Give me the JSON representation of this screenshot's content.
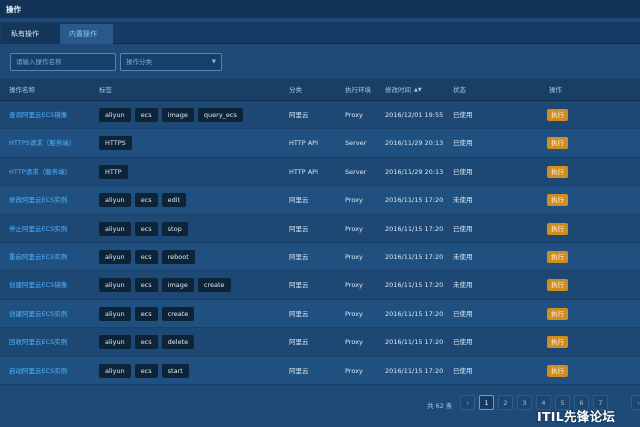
{
  "header": {
    "title": "操作"
  },
  "tabs": [
    {
      "label": "私有操作"
    },
    {
      "label": "内置操作"
    }
  ],
  "filters": {
    "search_placeholder": "请输入操作名称",
    "category_placeholder": "操作分类"
  },
  "table": {
    "columns": [
      "操作名称",
      "标签",
      "分类",
      "执行环境",
      "修改时间",
      "状态",
      "操作"
    ],
    "rows": [
      {
        "name": "查询阿里云ECS镜像",
        "tags": [
          "aliyun",
          "ecs",
          "image",
          "query_ecs"
        ],
        "category": "阿里云",
        "env": "Proxy",
        "time": "2016/12/01 19:55",
        "status": "已使用",
        "action": "执行"
      },
      {
        "name": "HTTPS请求（服务端）",
        "tags": [
          "HTTPS"
        ],
        "category": "HTTP API",
        "env": "Server",
        "time": "2016/11/29 20:13",
        "status": "已使用",
        "action": "执行"
      },
      {
        "name": "HTTP请求（服务端）",
        "tags": [
          "HTTP"
        ],
        "category": "HTTP API",
        "env": "Server",
        "time": "2016/11/29 20:13",
        "status": "已使用",
        "action": "执行"
      },
      {
        "name": "修改阿里云ECS实例",
        "tags": [
          "aliyun",
          "ecs",
          "edit"
        ],
        "category": "阿里云",
        "env": "Proxy",
        "time": "2016/11/15 17:20",
        "status": "未使用",
        "action": "执行"
      },
      {
        "name": "停止阿里云ECS实例",
        "tags": [
          "aliyun",
          "ecs",
          "stop"
        ],
        "category": "阿里云",
        "env": "Proxy",
        "time": "2016/11/15 17:20",
        "status": "已使用",
        "action": "执行"
      },
      {
        "name": "重启阿里云ECS实例",
        "tags": [
          "aliyun",
          "ecs",
          "reboot"
        ],
        "category": "阿里云",
        "env": "Proxy",
        "time": "2016/11/15 17:20",
        "status": "未使用",
        "action": "执行"
      },
      {
        "name": "创建阿里云ECS镜像",
        "tags": [
          "aliyun",
          "ecs",
          "image",
          "create"
        ],
        "category": "阿里云",
        "env": "Proxy",
        "time": "2016/11/15 17:20",
        "status": "未使用",
        "action": "执行"
      },
      {
        "name": "创建阿里云ECS实例",
        "tags": [
          "aliyun",
          "ecs",
          "create"
        ],
        "category": "阿里云",
        "env": "Proxy",
        "time": "2016/11/15 17:20",
        "status": "已使用",
        "action": "执行"
      },
      {
        "name": "回收阿里云ECS实例",
        "tags": [
          "aliyun",
          "ecs",
          "delete"
        ],
        "category": "阿里云",
        "env": "Proxy",
        "time": "2016/11/15 17:20",
        "status": "已使用",
        "action": "执行"
      },
      {
        "name": "启动阿里云ECS实例",
        "tags": [
          "aliyun",
          "ecs",
          "start"
        ],
        "category": "阿里云",
        "env": "Proxy",
        "time": "2016/11/15 17:20",
        "status": "已使用",
        "action": "执行"
      }
    ]
  },
  "pagination": {
    "total": "共 62 条",
    "prev": "‹",
    "pages": [
      "1",
      "2",
      "3",
      "4",
      "5",
      "6",
      "7"
    ],
    "current": "1",
    "next": "›"
  },
  "watermark": "ITIL先锋论坛"
}
